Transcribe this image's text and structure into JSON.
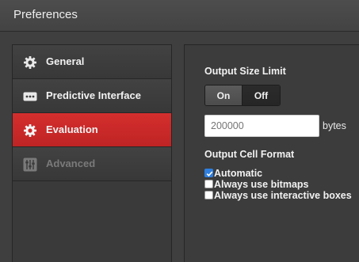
{
  "window": {
    "title": "Preferences"
  },
  "sidebar": {
    "items": [
      {
        "label": "General",
        "icon": "gear-icon",
        "state": "normal"
      },
      {
        "label": "Predictive Interface",
        "icon": "ellipsis-icon",
        "state": "normal"
      },
      {
        "label": "Evaluation",
        "icon": "gear-icon",
        "state": "selected"
      },
      {
        "label": "Advanced",
        "icon": "sliders-icon",
        "state": "disabled"
      }
    ]
  },
  "output_size_limit": {
    "title": "Output Size Limit",
    "on_label": "On",
    "off_label": "Off",
    "selected": "On",
    "value": "",
    "placeholder": "200000",
    "unit": "bytes"
  },
  "output_cell_format": {
    "title": "Output Cell Format",
    "options": [
      {
        "label": "Automatic",
        "checked": true
      },
      {
        "label": "Always use bitmaps",
        "checked": false
      },
      {
        "label": "Always use interactive boxes",
        "checked": false
      }
    ]
  },
  "colors": {
    "accent_selected": "#c92828",
    "checkbox_checked": "#2f7fe0",
    "background": "#3f3f3f"
  }
}
